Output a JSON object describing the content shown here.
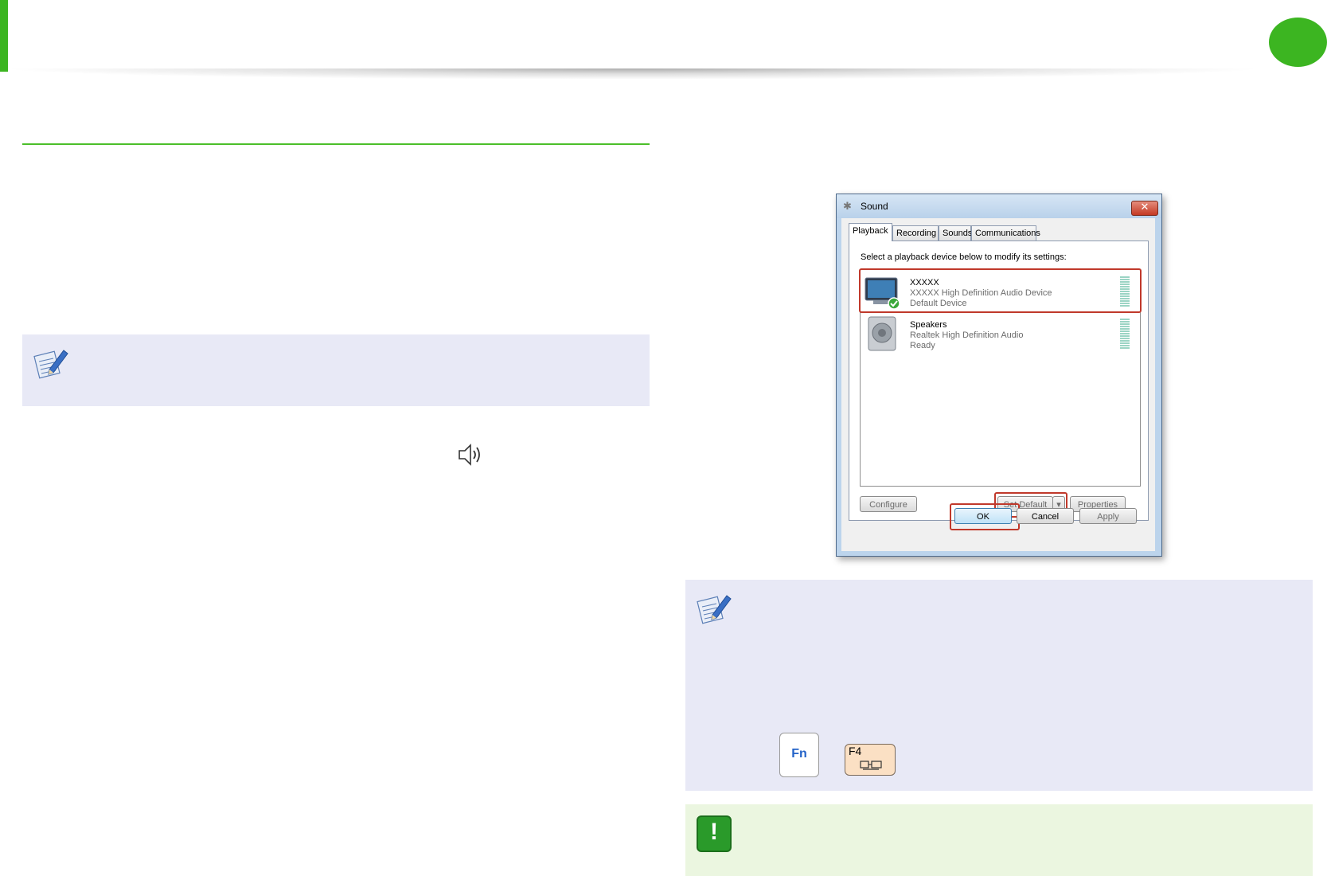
{
  "colors": {
    "accent_green": "#3cb521",
    "note_bg": "#e8e9f6",
    "warning_bg": "#ebf6e0",
    "highlight_red": "#c0392b"
  },
  "icons": {
    "note": "note-pencil-icon",
    "speaker": "speaker-volume-icon",
    "warning": "exclamation-icon",
    "sound_title": "sound-speaker-icon",
    "close": "close-icon",
    "monitor_device": "monitor-icon",
    "speakers_device": "speaker-device-icon",
    "default_check": "check-icon",
    "display_switch": "display-switch-icon"
  },
  "keys": {
    "fn": "Fn",
    "f4": "F4"
  },
  "sound_dialog": {
    "title": "Sound",
    "close_glyph": "✕",
    "tabs": [
      {
        "label": "Playback",
        "active": true
      },
      {
        "label": "Recording",
        "active": false
      },
      {
        "label": "Sounds",
        "active": false
      },
      {
        "label": "Communications",
        "active": false
      }
    ],
    "instruction": "Select a playback device below to modify its settings:",
    "devices": [
      {
        "name": "XXXXX",
        "driver": "XXXXX High Definition Audio Device",
        "status": "Default Device"
      },
      {
        "name": "Speakers",
        "driver": "Realtek High Definition Audio",
        "status": "Ready"
      }
    ],
    "buttons": {
      "configure": "Configure",
      "set_default": "Set Default",
      "set_default_arrow": "▾",
      "properties": "Properties",
      "ok": "OK",
      "cancel": "Cancel",
      "apply": "Apply"
    }
  }
}
